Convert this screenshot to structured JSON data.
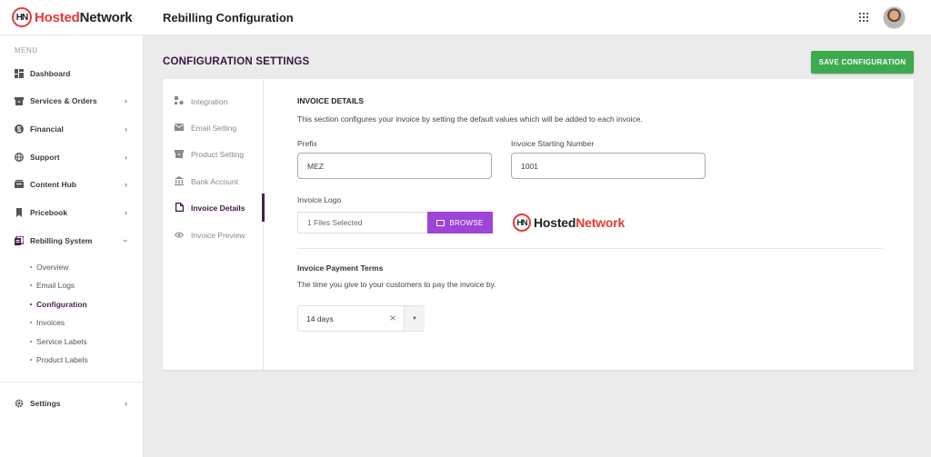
{
  "brand": {
    "name_part1": "Hosted",
    "name_part2": "Network",
    "mark": "HN"
  },
  "header": {
    "title": "Rebilling Configuration",
    "apps_icon": "apps-grid-icon",
    "avatar": "user-avatar"
  },
  "sidebar": {
    "menu_label": "MENU",
    "items": [
      {
        "label": "Dashboard",
        "icon": "dashboard-icon"
      },
      {
        "label": "Services  & Orders",
        "icon": "services-icon"
      },
      {
        "label": "Financial",
        "icon": "dollar-icon"
      },
      {
        "label": "Support",
        "icon": "globe-icon"
      },
      {
        "label": "Content Hub",
        "icon": "content-hub-icon"
      },
      {
        "label": "Pricebook",
        "icon": "bookmark-icon"
      },
      {
        "label": "Rebilling System",
        "icon": "rebilling-icon"
      }
    ],
    "sub_items": [
      "Overview",
      "Email Logs",
      "Configuration",
      "Invoices",
      "Service Labels",
      "Product Labels"
    ],
    "active_sub": "Configuration",
    "settings_label": "Settings"
  },
  "main": {
    "section_title": "CONFIGURATION SETTINGS",
    "save_label": "SAVE CONFIGURATION",
    "tabs": [
      "Integration",
      "Email Setting",
      "Product Setting",
      "Bank Account",
      "Invoice Details",
      "Invoice Preview"
    ],
    "active_tab": "Invoice Details"
  },
  "invoice": {
    "title": "INVOICE DETAILS",
    "description": "This section configures your invoice by setting the default values which will be added to each invoice.",
    "prefix_label": "Prefix",
    "prefix_value": "MEZ",
    "start_label": "Invoice Starting Number",
    "start_value": "1001",
    "logo_label": "Invoice Logo",
    "file_status": "1 Files Selected",
    "browse_label": "BROWSE",
    "terms_label": "Invoice Payment Terms",
    "terms_desc": "The time you give to your customers to pay the invoice by.",
    "terms_value": "14 days"
  },
  "colors": {
    "accent": "#4a1d4e",
    "save": "#3daa50",
    "browse": "#9c45d6",
    "brand_red": "#e53935"
  }
}
